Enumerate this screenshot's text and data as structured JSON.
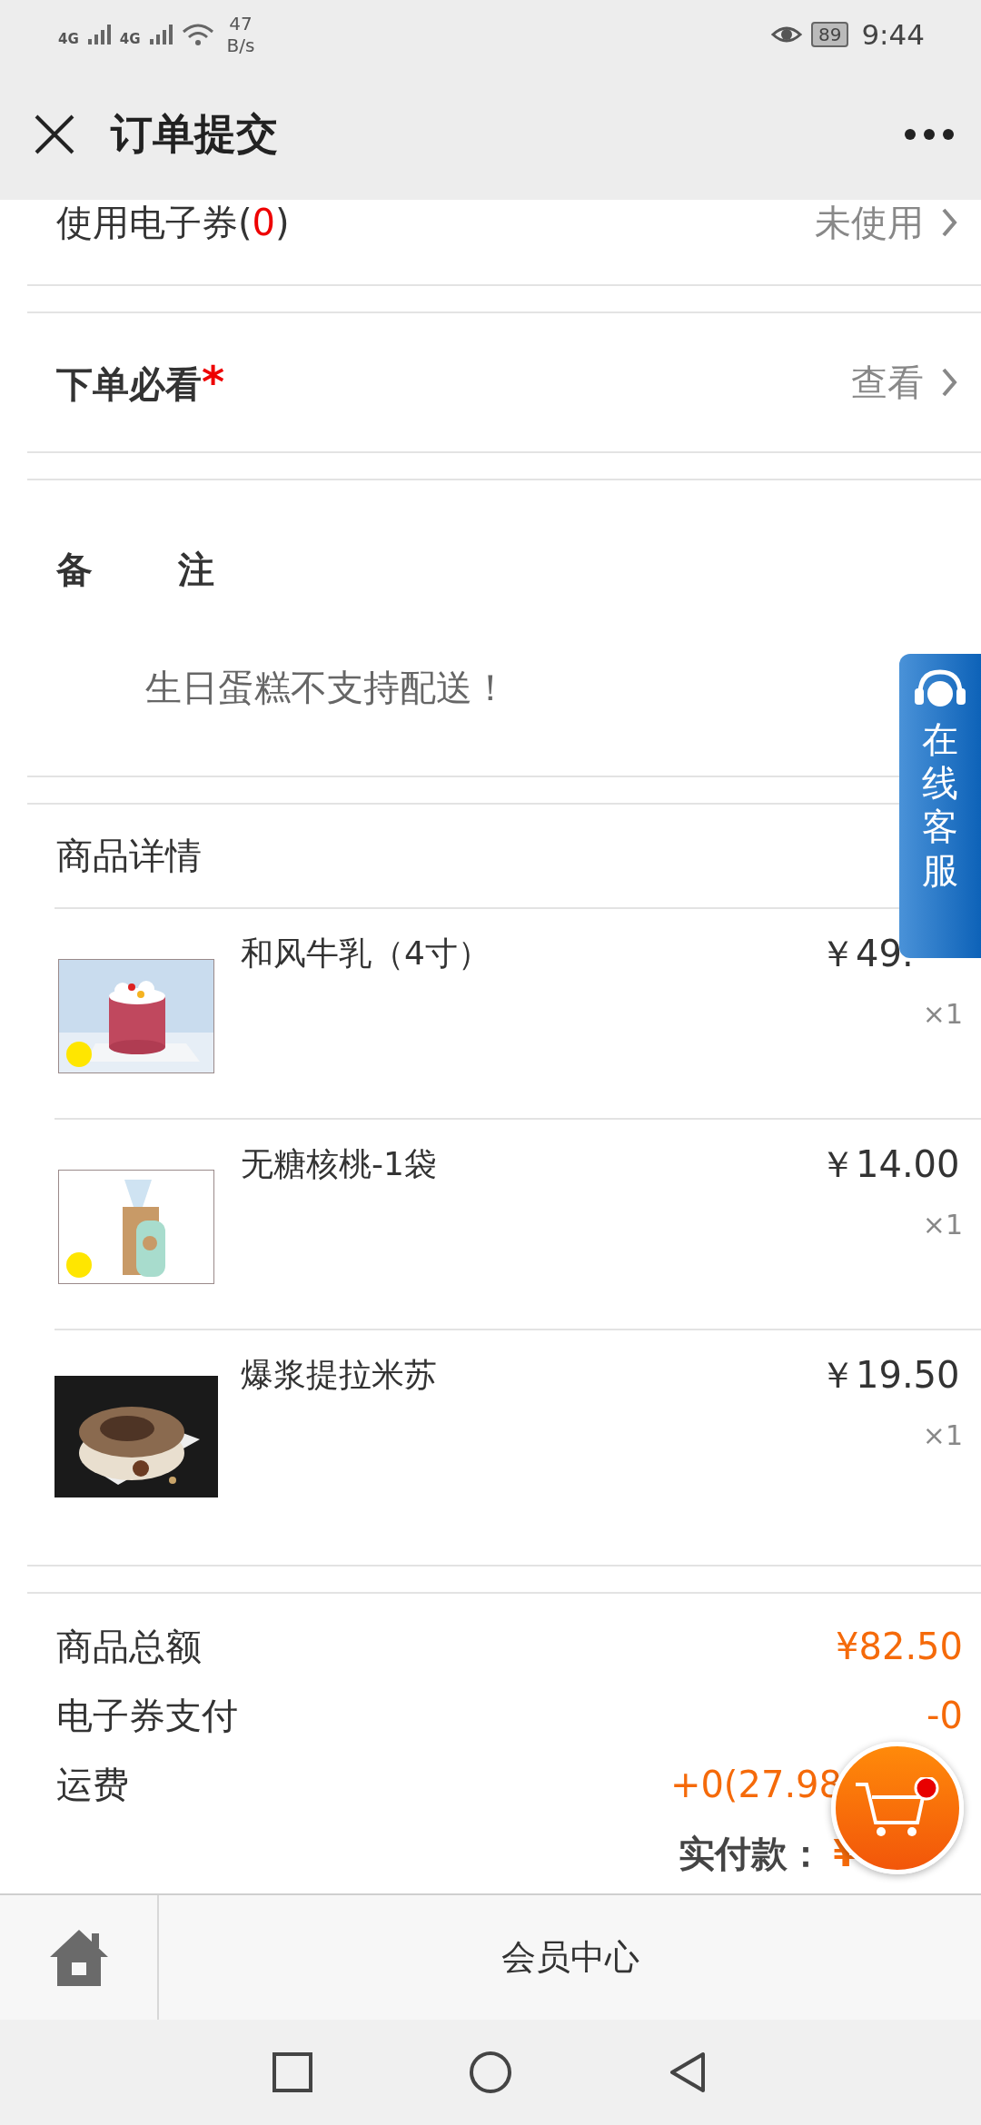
{
  "status_bar": {
    "network_1": "4G",
    "network_2": "4G",
    "speed_value": "47",
    "speed_unit": "B/s",
    "battery": "89",
    "time": "9:44"
  },
  "header": {
    "title": "订单提交"
  },
  "coupon_row": {
    "label_prefix": "使用电子券(",
    "count": "0",
    "label_suffix": ")",
    "value": "未使用"
  },
  "notice_row": {
    "label": "下单必看",
    "required_mark": "*",
    "value": "查看"
  },
  "remark": {
    "label": "备 注",
    "text": "生日蛋糕不支持配送！"
  },
  "products": {
    "title": "商品详情",
    "items": [
      {
        "name": "和风牛乳（4寸）",
        "price": "￥49.",
        "quantity": "×1"
      },
      {
        "name": "无糖核桃-1袋",
        "price": "￥14.00",
        "quantity": "×1"
      },
      {
        "name": "爆浆提拉米苏",
        "price": "￥19.50",
        "quantity": "×1"
      }
    ]
  },
  "summary": [
    {
      "label": "商品总额",
      "value": "¥82.50"
    },
    {
      "label": "电子券支付",
      "value": "-0"
    },
    {
      "label": "运费",
      "value": "+0(27.98"
    },
    {
      "label": "实付款：",
      "value": "¥"
    }
  ],
  "bottom_nav": {
    "label": "会员中心"
  },
  "service_button": {
    "label": "在线客服"
  }
}
